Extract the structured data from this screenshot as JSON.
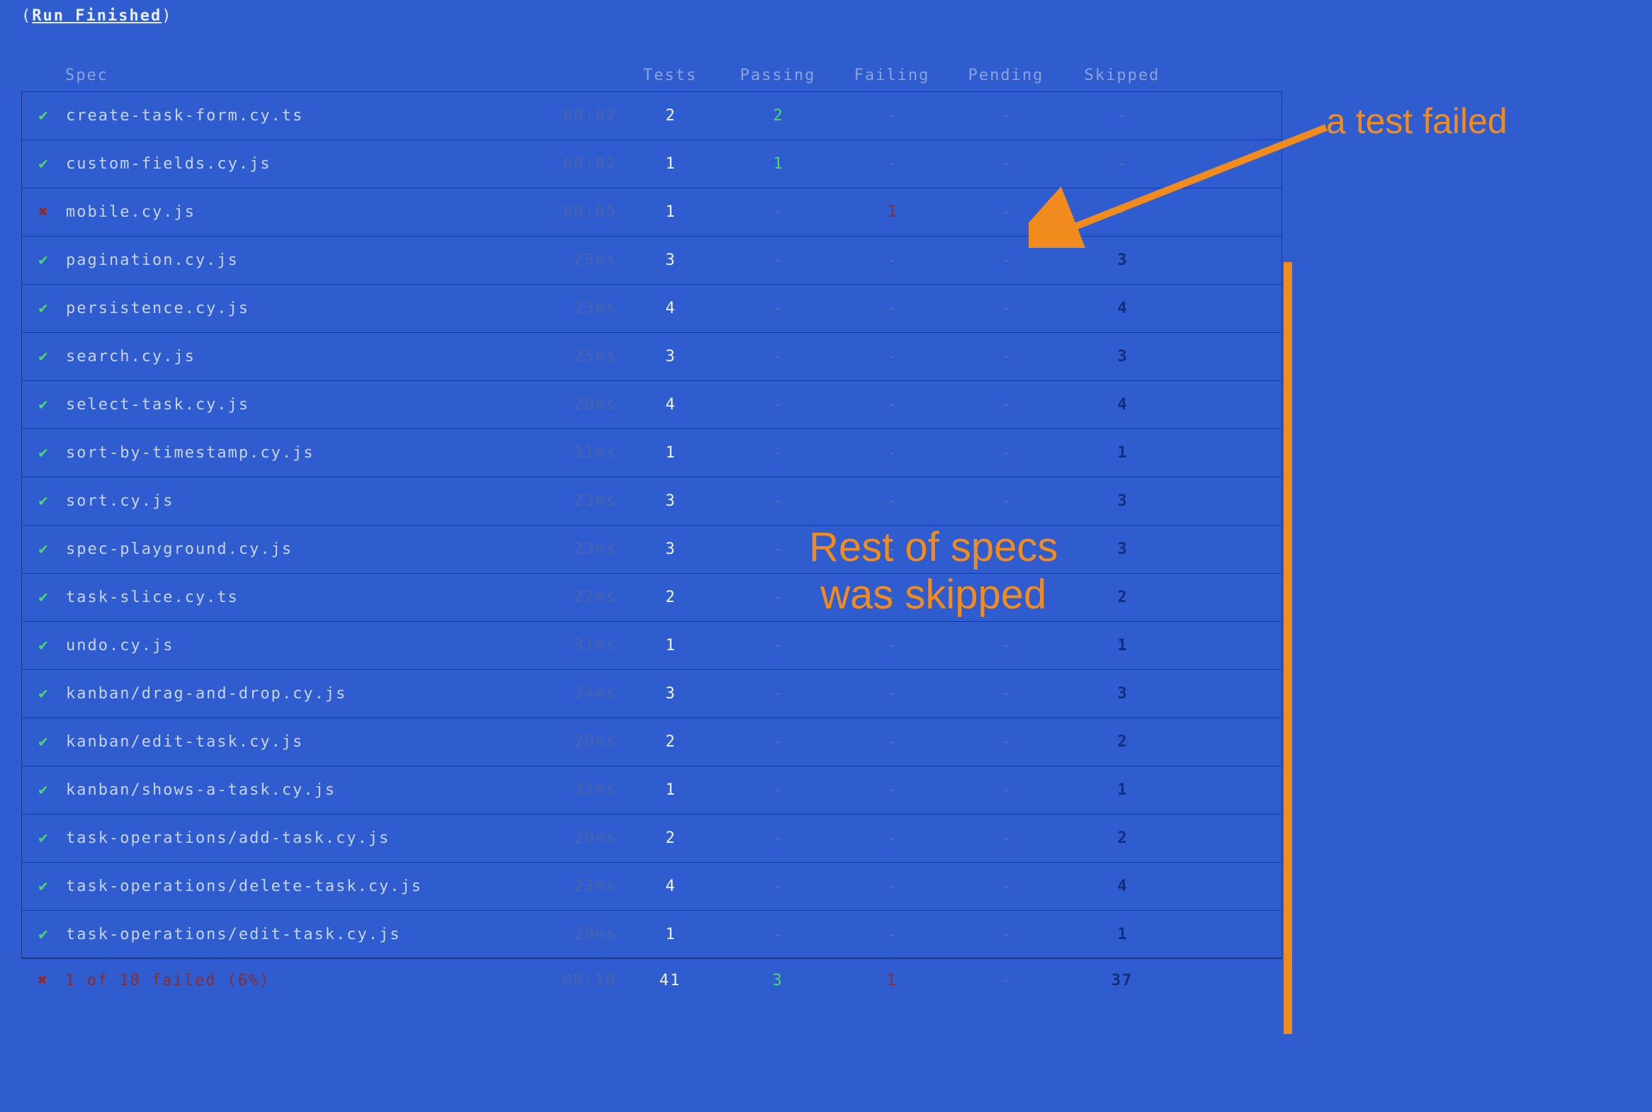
{
  "header": {
    "prefix": "(",
    "title": "Run Finished",
    "suffix": ")"
  },
  "columns": {
    "spec": "Spec",
    "tests": "Tests",
    "passing": "Passing",
    "failing": "Failing",
    "pending": "Pending",
    "skipped": "Skipped"
  },
  "rows": [
    {
      "status": "pass",
      "spec": "create-task-form.cy.ts",
      "time": "00:02",
      "tests": "2",
      "passing": "2",
      "failing": "-",
      "pending": "-",
      "skipped": "-"
    },
    {
      "status": "pass",
      "spec": "custom-fields.cy.js",
      "time": "00:02",
      "tests": "1",
      "passing": "1",
      "failing": "-",
      "pending": "-",
      "skipped": "-"
    },
    {
      "status": "fail",
      "spec": "mobile.cy.js",
      "time": "00:05",
      "tests": "1",
      "passing": "-",
      "failing": "1",
      "pending": "-",
      "skipped": "-"
    },
    {
      "status": "pass",
      "spec": "pagination.cy.js",
      "time": "25ms",
      "tests": "3",
      "passing": "-",
      "failing": "-",
      "pending": "-",
      "skipped": "3"
    },
    {
      "status": "pass",
      "spec": "persistence.cy.js",
      "time": "23ms",
      "tests": "4",
      "passing": "-",
      "failing": "-",
      "pending": "-",
      "skipped": "4"
    },
    {
      "status": "pass",
      "spec": "search.cy.js",
      "time": "25ms",
      "tests": "3",
      "passing": "-",
      "failing": "-",
      "pending": "-",
      "skipped": "3"
    },
    {
      "status": "pass",
      "spec": "select-task.cy.js",
      "time": "20ms",
      "tests": "4",
      "passing": "-",
      "failing": "-",
      "pending": "-",
      "skipped": "4"
    },
    {
      "status": "pass",
      "spec": "sort-by-timestamp.cy.js",
      "time": "31ms",
      "tests": "1",
      "passing": "-",
      "failing": "-",
      "pending": "-",
      "skipped": "1"
    },
    {
      "status": "pass",
      "spec": "sort.cy.js",
      "time": "23ms",
      "tests": "3",
      "passing": "-",
      "failing": "-",
      "pending": "-",
      "skipped": "3"
    },
    {
      "status": "pass",
      "spec": "spec-playground.cy.js",
      "time": "23ms",
      "tests": "3",
      "passing": "-",
      "failing": "-",
      "pending": "-",
      "skipped": "3"
    },
    {
      "status": "pass",
      "spec": "task-slice.cy.ts",
      "time": "22ms",
      "tests": "2",
      "passing": "-",
      "failing": "-",
      "pending": "-",
      "skipped": "2"
    },
    {
      "status": "pass",
      "spec": "undo.cy.js",
      "time": "31ms",
      "tests": "1",
      "passing": "-",
      "failing": "-",
      "pending": "-",
      "skipped": "1"
    },
    {
      "status": "pass",
      "spec": "kanban/drag-and-drop.cy.js",
      "time": "24ms",
      "tests": "3",
      "passing": "-",
      "failing": "-",
      "pending": "-",
      "skipped": "3"
    },
    {
      "status": "pass",
      "spec": "kanban/edit-task.cy.js",
      "time": "20ms",
      "tests": "2",
      "passing": "-",
      "failing": "-",
      "pending": "-",
      "skipped": "2"
    },
    {
      "status": "pass",
      "spec": "kanban/shows-a-task.cy.js",
      "time": "32ms",
      "tests": "1",
      "passing": "-",
      "failing": "-",
      "pending": "-",
      "skipped": "1"
    },
    {
      "status": "pass",
      "spec": "task-operations/add-task.cy.js",
      "time": "20ms",
      "tests": "2",
      "passing": "-",
      "failing": "-",
      "pending": "-",
      "skipped": "2"
    },
    {
      "status": "pass",
      "spec": "task-operations/delete-task.cy.js",
      "time": "22ms",
      "tests": "4",
      "passing": "-",
      "failing": "-",
      "pending": "-",
      "skipped": "4"
    },
    {
      "status": "pass",
      "spec": "task-operations/edit-task.cy.js",
      "time": "29ms",
      "tests": "1",
      "passing": "-",
      "failing": "-",
      "pending": "-",
      "skipped": "1"
    }
  ],
  "summary": {
    "status": "fail",
    "text": "1 of 18 failed (6%)",
    "time": "00:10",
    "tests": "41",
    "passing": "3",
    "failing": "1",
    "pending": "-",
    "skipped": "37"
  },
  "annotations": {
    "failed": "a test failed",
    "skipped_line1": "Rest of specs",
    "skipped_line2": "was skipped"
  },
  "icons": {
    "pass": "✔",
    "fail": "✖"
  },
  "colors": {
    "background": "#2f5dcf",
    "border": "#1f3b84",
    "pass": "#47d96e",
    "fail": "#8d2c2c",
    "skip": "#132d7a",
    "annotation": "#f28b1e"
  }
}
